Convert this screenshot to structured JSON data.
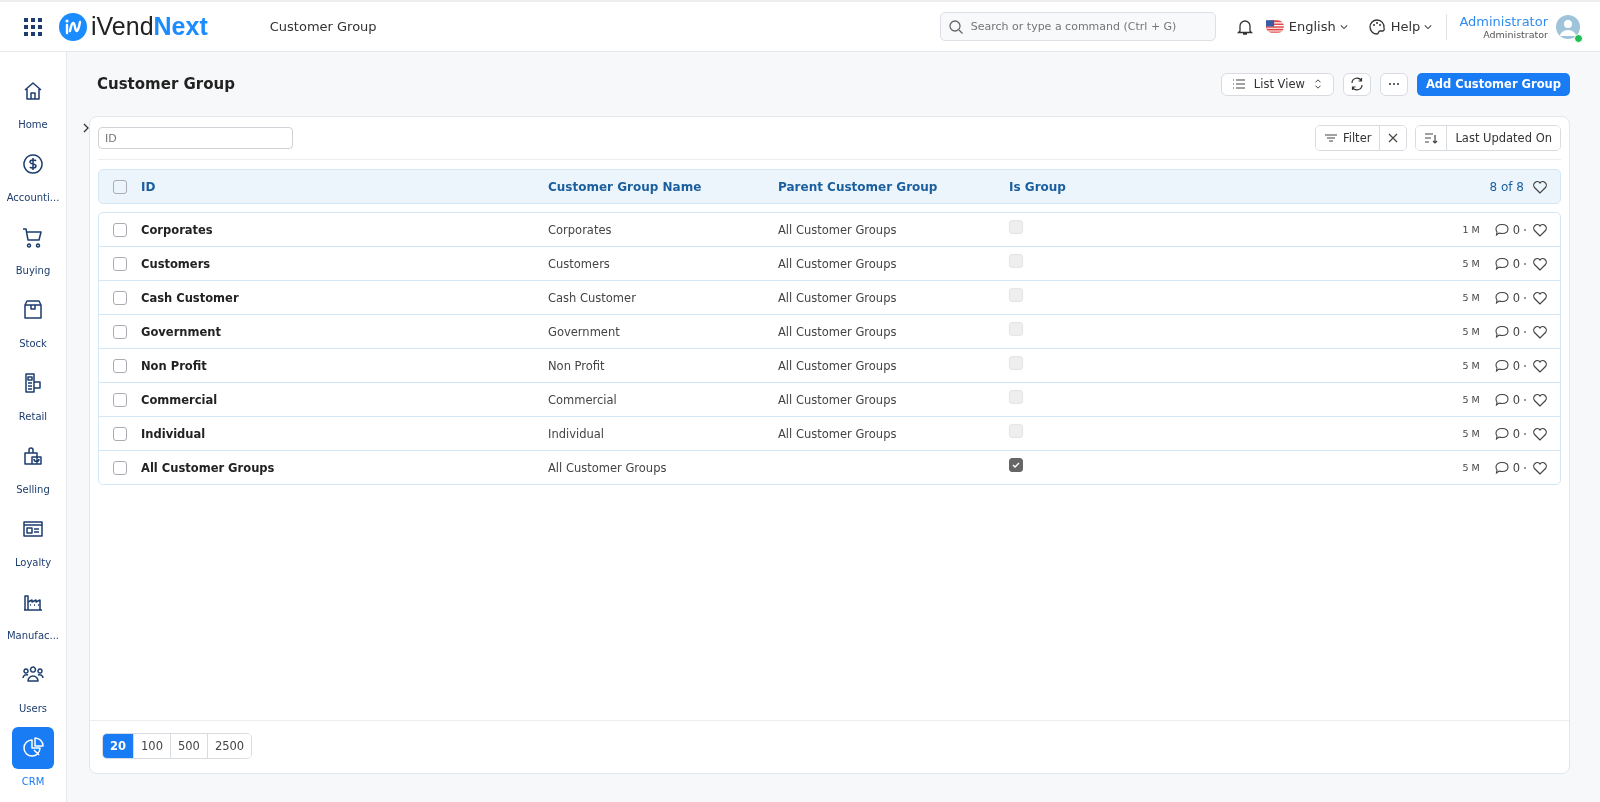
{
  "topbar": {
    "logo_main": "iVend",
    "logo_accent": "Next",
    "breadcrumb": "Customer Group",
    "search": {
      "placeholder": "Search or type a command (Ctrl + G)"
    },
    "language": "English",
    "help": "Help",
    "user": {
      "name": "Administrator",
      "role": "Administrator",
      "online": true
    }
  },
  "sidebar": {
    "items": [
      {
        "label": "Home",
        "selected": false
      },
      {
        "label": "Accounti...",
        "selected": false
      },
      {
        "label": "Buying",
        "selected": false
      },
      {
        "label": "Stock",
        "selected": false
      },
      {
        "label": "Retail",
        "selected": false
      },
      {
        "label": "Selling",
        "selected": false
      },
      {
        "label": "Loyalty",
        "selected": false
      },
      {
        "label": "Manufac...",
        "selected": false
      },
      {
        "label": "Users",
        "selected": false
      },
      {
        "label": "CRM",
        "selected": true
      }
    ]
  },
  "page": {
    "title": "Customer Group",
    "view_button": "List View",
    "add_button": "Add Customer Group"
  },
  "filters": {
    "id_field": {
      "placeholder": "ID"
    },
    "filter_button": "Filter",
    "sort_button": "Last Updated On"
  },
  "table": {
    "columns": [
      "ID",
      "Customer Group Name",
      "Parent Customer Group",
      "Is Group"
    ],
    "count": "8 of 8",
    "header_checked": false,
    "rows": [
      {
        "id": "Corporates",
        "name": "Corporates",
        "parent": "All Customer Groups",
        "is_group": false,
        "checked": false,
        "modified": "1 M",
        "comments": "0"
      },
      {
        "id": "Customers",
        "name": "Customers",
        "parent": "All Customer Groups",
        "is_group": false,
        "checked": false,
        "modified": "5 M",
        "comments": "0"
      },
      {
        "id": "Cash Customer",
        "name": "Cash Customer",
        "parent": "All Customer Groups",
        "is_group": false,
        "checked": false,
        "modified": "5 M",
        "comments": "0"
      },
      {
        "id": "Government",
        "name": "Government",
        "parent": "All Customer Groups",
        "is_group": false,
        "checked": false,
        "modified": "5 M",
        "comments": "0"
      },
      {
        "id": "Non Profit",
        "name": "Non Profit",
        "parent": "All Customer Groups",
        "is_group": false,
        "checked": false,
        "modified": "5 M",
        "comments": "0"
      },
      {
        "id": "Commercial",
        "name": "Commercial",
        "parent": "All Customer Groups",
        "is_group": false,
        "checked": false,
        "modified": "5 M",
        "comments": "0"
      },
      {
        "id": "Individual",
        "name": "Individual",
        "parent": "All Customer Groups",
        "is_group": false,
        "checked": false,
        "modified": "5 M",
        "comments": "0"
      },
      {
        "id": "All Customer Groups",
        "name": "All Customer Groups",
        "parent": "",
        "is_group": true,
        "checked": false,
        "modified": "5 M",
        "comments": "0"
      }
    ]
  },
  "page_sizes": [
    {
      "label": "20",
      "selected": true
    },
    {
      "label": "100",
      "selected": false
    },
    {
      "label": "500",
      "selected": false
    },
    {
      "label": "2500",
      "selected": false
    }
  ]
}
